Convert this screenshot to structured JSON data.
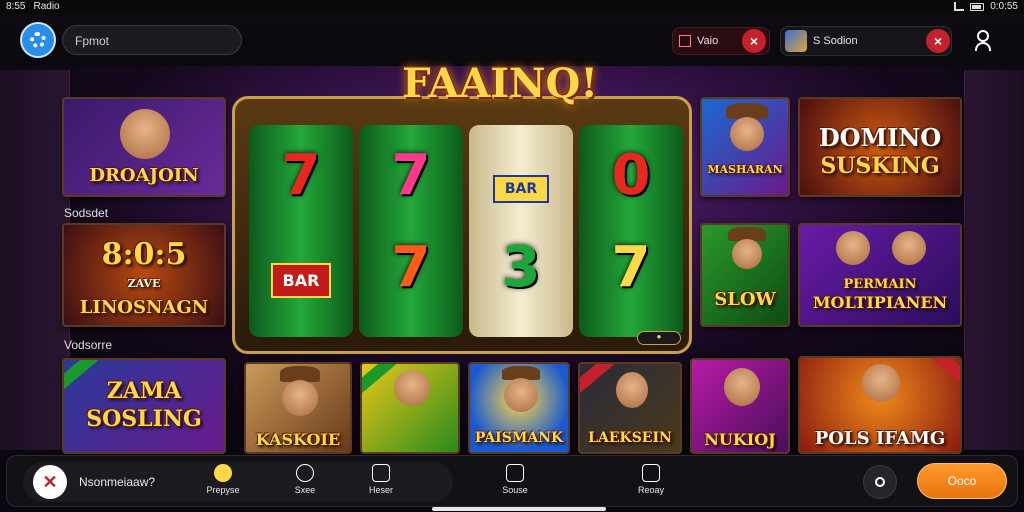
{
  "status_bar": {
    "left_time": "8:55",
    "left_label": "Radio",
    "right_time": "0:0:55"
  },
  "top_bar": {
    "search_text": "Fpmot",
    "red_chip_label": "Vaio",
    "session_label": "S Sodion"
  },
  "sections": {
    "first": "Sodsdet",
    "second": "Vodsorre"
  },
  "slot_machine": {
    "title": "FAAINQ!",
    "reel_symbols": [
      "7",
      "7",
      "BAR",
      "0",
      "BAR",
      "7",
      "3",
      "7"
    ],
    "badge_label": "●"
  },
  "tiles": {
    "t1": "DROAJOIN",
    "t2_top": "8:0:5",
    "t2_mid": "ZAVE",
    "t2_bot": "LINOSNAGN",
    "t3_top": "ZAMA",
    "t3_bot": "SOSLING",
    "t4": "MASHARAN",
    "t5_top": "DOMINO",
    "t5_bot": "SUSKING",
    "t6": "SLOW",
    "t7_top": "PERMAIN",
    "t7_bot": "MOLTIPIANEN",
    "t8": "KASKOIE",
    "t9": "",
    "t10": "PAISMANK",
    "t11": "LAEKSEIN",
    "t12": "NUKIOJ",
    "t13": "POLS IFAMG"
  },
  "bottom_nav": {
    "question": "Nsonmeiaaw?",
    "items": [
      "Prepyse",
      "Sxee",
      "Heser",
      "Souse",
      "Reoay"
    ],
    "cta_label": "Ooco"
  }
}
